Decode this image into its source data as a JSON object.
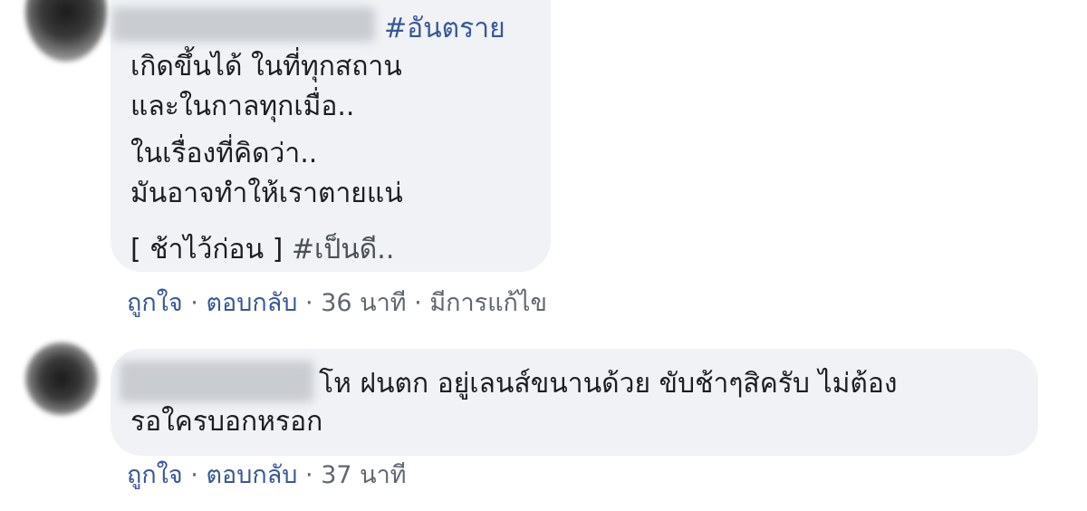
{
  "comments": [
    {
      "hashtag_top": "#อันตราย",
      "lines": [
        "เกิดขึ้นได้ ในที่ทุกสถาน",
        "และในกาลทุกเมื่อ..",
        "ในเรื่องที่คิดว่า..",
        "มันอาจทำให้เราตายแน่"
      ],
      "last_line_prefix": "[ ช้าไว้ก่อน ] ",
      "last_line_hashtag": "#เป็นดี..",
      "actions": {
        "like": "ถูกใจ",
        "reply": "ตอบกลับ",
        "time": "36 นาที",
        "edited": "มีการแก้ไข",
        "separator": "·"
      }
    },
    {
      "line1": "โห ฝนตก อยู่เลนส์ขนานด้วย ขับช้าๆสิครับ ไม่ต้อง",
      "line2": "รอใครบอกหรอก",
      "actions": {
        "like": "ถูกใจ",
        "reply": "ตอบกลับ",
        "time": "37 นาที",
        "separator": "·"
      }
    }
  ]
}
